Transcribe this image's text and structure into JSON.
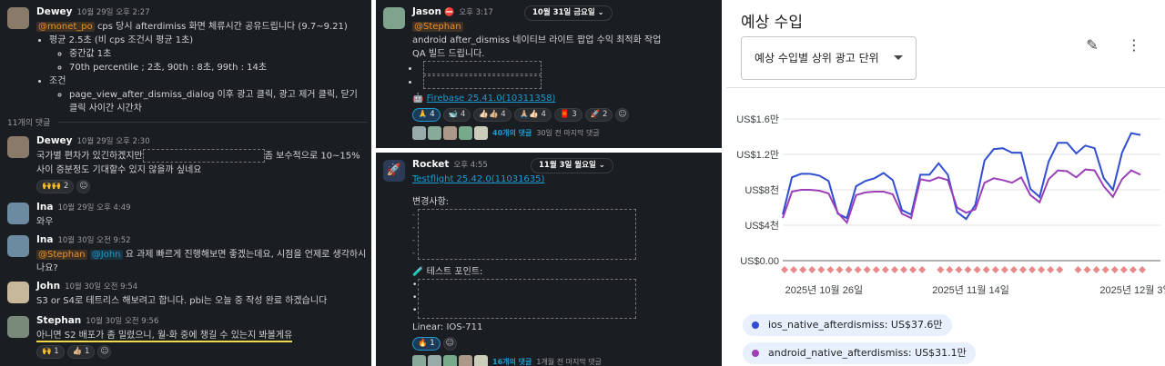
{
  "left_thread": {
    "parent": {
      "author": "Dewey",
      "time": "10월 29일 오후 2:27",
      "mention": "@monet_po",
      "text": "cps 당시 afterdimiss 화면 체류시간 공유드립니다 (9.7~9.21)",
      "bullets": [
        {
          "text": "평균 2.5초 (비 cps 조건시 평균 1초)",
          "sub": [
            "중간값 1초",
            "70th percentile ; 2초, 90th : 8초, 99th : 14초"
          ]
        },
        {
          "text": "조건",
          "sub": [
            "page_view_after_dismiss_dialog 이후 광고 클릭, 광고 제거 클릭, 닫기 클릭 사이간 시간차"
          ]
        }
      ]
    },
    "reply_count": "11개의 댓글",
    "replies": [
      {
        "author": "Dewey",
        "time": "10월 29일 오후 2:30",
        "text_a": "국가별 편차가 있긴하겠지만",
        "text_b": "좀 보수적으로 10~15%",
        "text_c": "사이 증분정도 기대할수 있지 않을까 싶네요",
        "reaction": "🙌🙌 2"
      },
      {
        "author": "Ina",
        "time": "10월 29일 오후 4:49",
        "text": "와우"
      },
      {
        "author": "Ina",
        "time": "10월 30일 오전 9:52",
        "mention1": "@Stephan",
        "mention2": "@John",
        "text": "요 과제 빠르게 진행해보면 좋겠는데요, 시점을 언제로 생각하시나요?"
      },
      {
        "author": "John",
        "time": "10월 30일 오전 9:54",
        "text": "S3 or S4로 테트리스 해보려고 합니다. pbi는 오늘 중 작성 완료 하겠습니다"
      },
      {
        "author": "Stephan",
        "time": "10월 30일 오전 9:56",
        "text": "아니면 S2 배포가 좀 밀렸으니, 월-화 중에 챙길 수 있는지 봐볼게유",
        "reactions": [
          "🙌 1",
          "👍🏼 1"
        ]
      }
    ]
  },
  "mid_top": {
    "author": "Jason",
    "status_emoji": "⛔",
    "time": "오후 3:17",
    "date_pill": "10월 31일 금요일",
    "mention": "@Stephan",
    "line1": "android after_dismiss 네이티브 라이트 팝업 수익 최적화 작업",
    "line2": "QA 빌드 드립니다.",
    "link": "Firebase 25.41.0(10311358)",
    "reactions": [
      "🙏 4",
      "🐋 4",
      "👍🏻👍🏼 4",
      "🙏🏼👍🏻 4",
      "🧧 3",
      "🚀 2"
    ],
    "thread_count": "40개의 댓글",
    "thread_meta": "30일 전 마지막 댓글"
  },
  "mid_bottom": {
    "author": "Rocket",
    "time": "오후 4:55",
    "date_pill": "11월 3일 월요일",
    "link": "Testflight 25.42.0(11031635)",
    "changes_label": "변경사항:",
    "test_label": "테스트 포인트:",
    "linear": "Linear: IOS-711",
    "reaction": "🔥 1",
    "thread_count": "16개의 댓글",
    "thread_meta": "1개월 전 마지막 댓글"
  },
  "right_panel": {
    "title": "예상 수입",
    "dropdown": "예상 수입별 상위 광고 단위",
    "legend": [
      {
        "label": "ios_native_afterdismiss: US$37.6만",
        "color": "#2f4fd0"
      },
      {
        "label": "android_native_afterdismiss: US$31.1만",
        "color": "#9c3fb8"
      }
    ]
  },
  "chart_data": {
    "type": "line",
    "yticks": [
      "US$1.6만",
      "US$1.2만",
      "US$8천",
      "US$4천",
      "US$0.00"
    ],
    "ylim": [
      0,
      16000
    ],
    "xticks": [
      "2025년 10월 26일",
      "2025년 11월 14일",
      "2025년 12월 3일"
    ],
    "series": [
      {
        "name": "ios_native_afterdismiss",
        "color": "#2f4fd0",
        "values": [
          5200,
          9400,
          9800,
          9800,
          9600,
          9000,
          5300,
          4800,
          8400,
          9000,
          9300,
          9900,
          9100,
          5700,
          5200,
          9700,
          9700,
          11000,
          9700,
          5500,
          4700,
          6300,
          11300,
          12600,
          12700,
          12200,
          12200,
          8100,
          7200,
          11200,
          13300,
          13300,
          12100,
          13000,
          12700,
          9300,
          8000,
          12200,
          14400,
          14200
        ]
      },
      {
        "name": "android_native_afterdismiss",
        "color": "#9c3fb8",
        "values": [
          4800,
          7800,
          8000,
          8000,
          7900,
          7600,
          5400,
          4300,
          7400,
          7700,
          7800,
          7800,
          7500,
          5300,
          4800,
          9200,
          9000,
          9400,
          9100,
          6000,
          5400,
          5800,
          8800,
          9300,
          9100,
          8800,
          9400,
          7400,
          6600,
          9200,
          10200,
          10100,
          9400,
          10300,
          10200,
          8400,
          7200,
          9200,
          10200,
          9700
        ]
      },
      {
        "name": "",
        "color": "#e88a8a",
        "marker": "diamond",
        "values": [
          0,
          0,
          0,
          0,
          0,
          0,
          0,
          0,
          0,
          0,
          0,
          0,
          0,
          0,
          0,
          0,
          0,
          0,
          0,
          0,
          0,
          0,
          0,
          0,
          0,
          0,
          0,
          0,
          0,
          0,
          0,
          0,
          0,
          0,
          0,
          0,
          0,
          0,
          0,
          0
        ]
      }
    ],
    "grid": true
  }
}
